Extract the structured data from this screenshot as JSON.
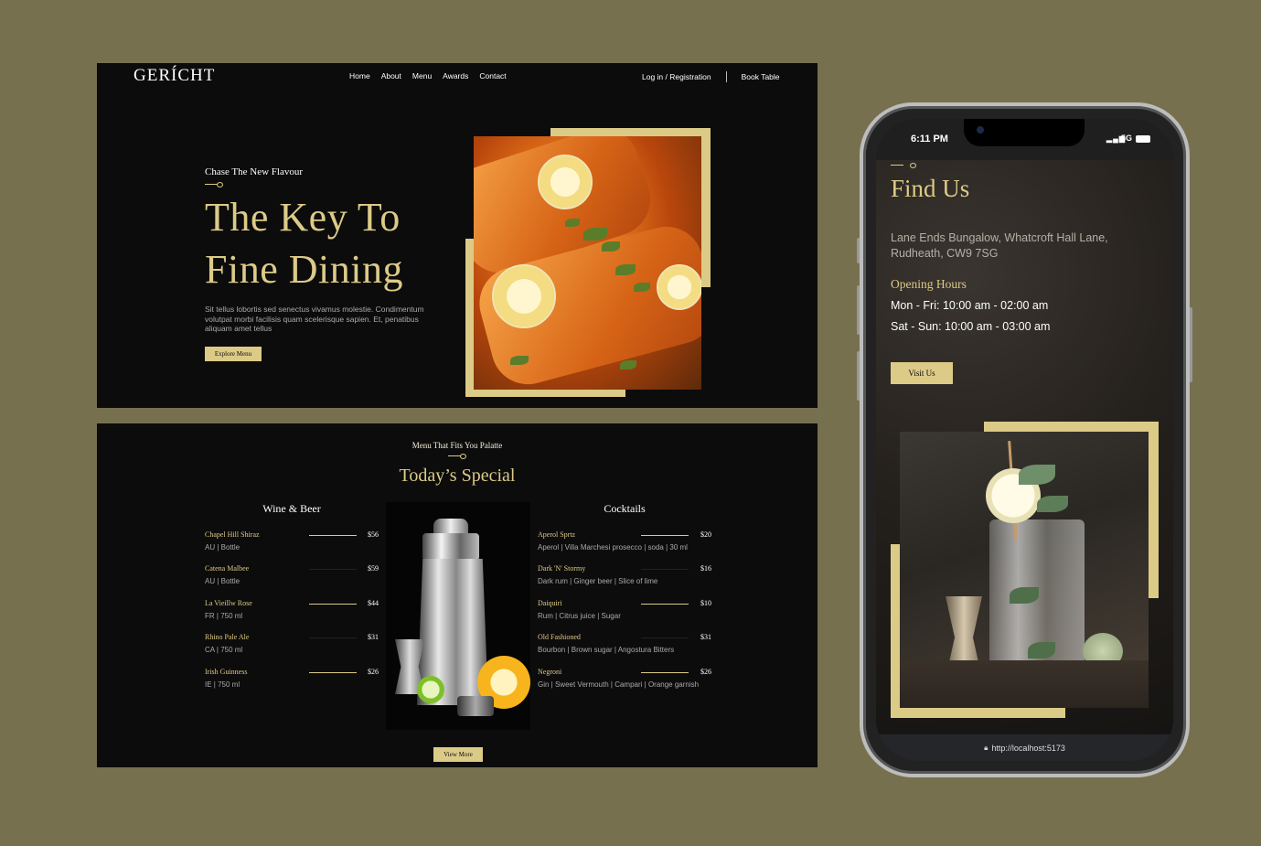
{
  "hero": {
    "logo": "GERÍCHT",
    "nav": [
      "Home",
      "About",
      "Menu",
      "Awards",
      "Contact"
    ],
    "login": "Log in / Registration",
    "book": "Book Table",
    "subtitle": "Chase The New Flavour",
    "title_line1": "The Key To",
    "title_line2": "Fine Dining",
    "description": "Sit tellus lobortis sed senectus vivamus molestie. Condimentum volutpat morbi facilisis quam scelerisque sapien. Et, penatibus aliquam amet tellus",
    "button": "Explore Menu"
  },
  "menu": {
    "subtitle": "Menu That Fits You Palatte",
    "title": "Today’s Special",
    "wine_heading": "Wine & Beer",
    "cocktails_heading": "Cocktails",
    "wine": [
      {
        "name": "Chapel Hill Shiraz",
        "price": "$56",
        "tags": "AU | Bottle"
      },
      {
        "name": "Catena Malbee",
        "price": "$59",
        "tags": "AU | Bottle"
      },
      {
        "name": "La Vieillw Rose",
        "price": "$44",
        "tags": "FR | 750 ml"
      },
      {
        "name": "Rhino Pale Ale",
        "price": "$31",
        "tags": "CA | 750 ml"
      },
      {
        "name": "Irish Guinness",
        "price": "$26",
        "tags": "IE | 750 ml"
      }
    ],
    "cocktails": [
      {
        "name": "Aperol Sprtz",
        "price": "$20",
        "tags": "Aperol | Villa Marchesi prosecco | soda | 30 ml"
      },
      {
        "name": "Dark 'N' Stormy",
        "price": "$16",
        "tags": "Dark rum | Ginger beer | Slice of lime"
      },
      {
        "name": "Daiquiri",
        "price": "$10",
        "tags": "Rum | Citrus juice | Sugar"
      },
      {
        "name": "Old Fashioned",
        "price": "$31",
        "tags": "Bourbon | Brown sugar | Angostura Bitters"
      },
      {
        "name": "Negroni",
        "price": "$26",
        "tags": "Gin | Sweet Vermouth | Campari | Orange garnish"
      }
    ],
    "button": "View More"
  },
  "phone": {
    "time": "6:11 PM",
    "network": "5G",
    "title": "Find Us",
    "address": "Lane Ends Bungalow, Whatcroft Hall Lane, Rudheath, CW9 7SG",
    "hours_title": "Opening Hours",
    "hours_weekday": "Mon - Fri: 10:00 am - 02:00 am",
    "hours_weekend": "Sat - Sun: 10:00 am - 03:00 am",
    "button": "Visit Us",
    "url": "http://localhost:5173"
  },
  "colors": {
    "background": "#77704f",
    "panel": "#0c0c0c",
    "gold": "#dcca87"
  }
}
